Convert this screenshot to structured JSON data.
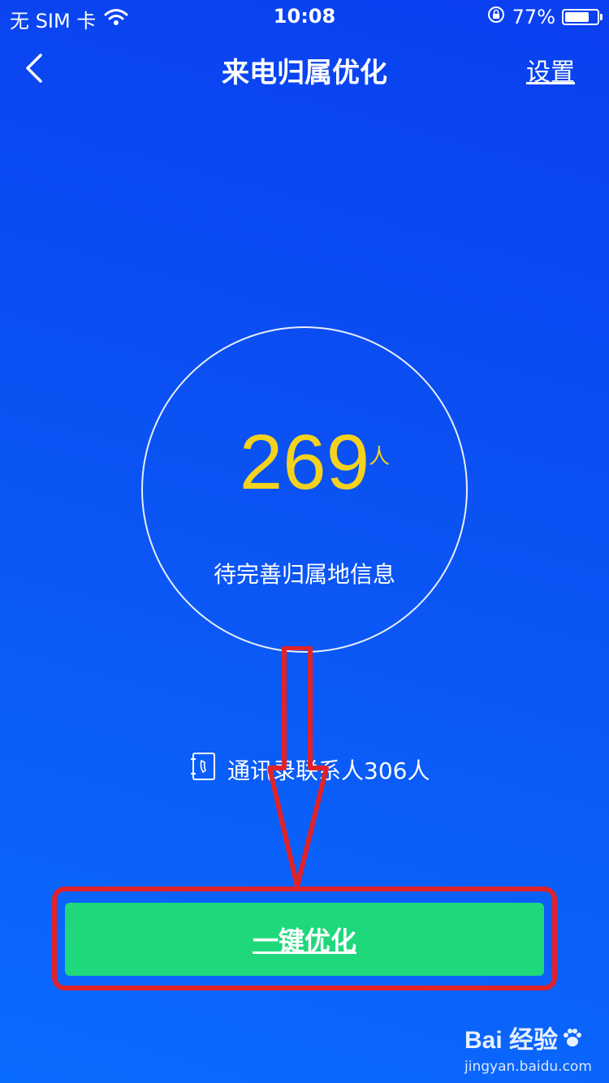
{
  "status_bar": {
    "carrier": "无 SIM 卡",
    "time": "10:08",
    "battery_percent": "77%",
    "battery_level": 0.77,
    "icons": [
      "wifi-icon",
      "orientation-lock-icon",
      "battery-icon"
    ]
  },
  "nav": {
    "title": "来电归属优化",
    "settings_label": "设置",
    "back_icon": "chevron-left-icon"
  },
  "summary": {
    "count": "269",
    "unit": "人",
    "caption": "待完善归属地信息"
  },
  "contacts": {
    "icon": "contacts-book-icon",
    "text": "通讯录联系人306人"
  },
  "action": {
    "button_label": "一键优化"
  },
  "watermark": {
    "logo_text": "Bai 经验",
    "url": "jingyan.baidu.com"
  },
  "colors": {
    "background_top": "#0a3ff0",
    "background_bottom": "#0a6bff",
    "count_color": "#f4d21e",
    "button_color": "#1fd87b",
    "annotation_color": "#e0232a"
  }
}
